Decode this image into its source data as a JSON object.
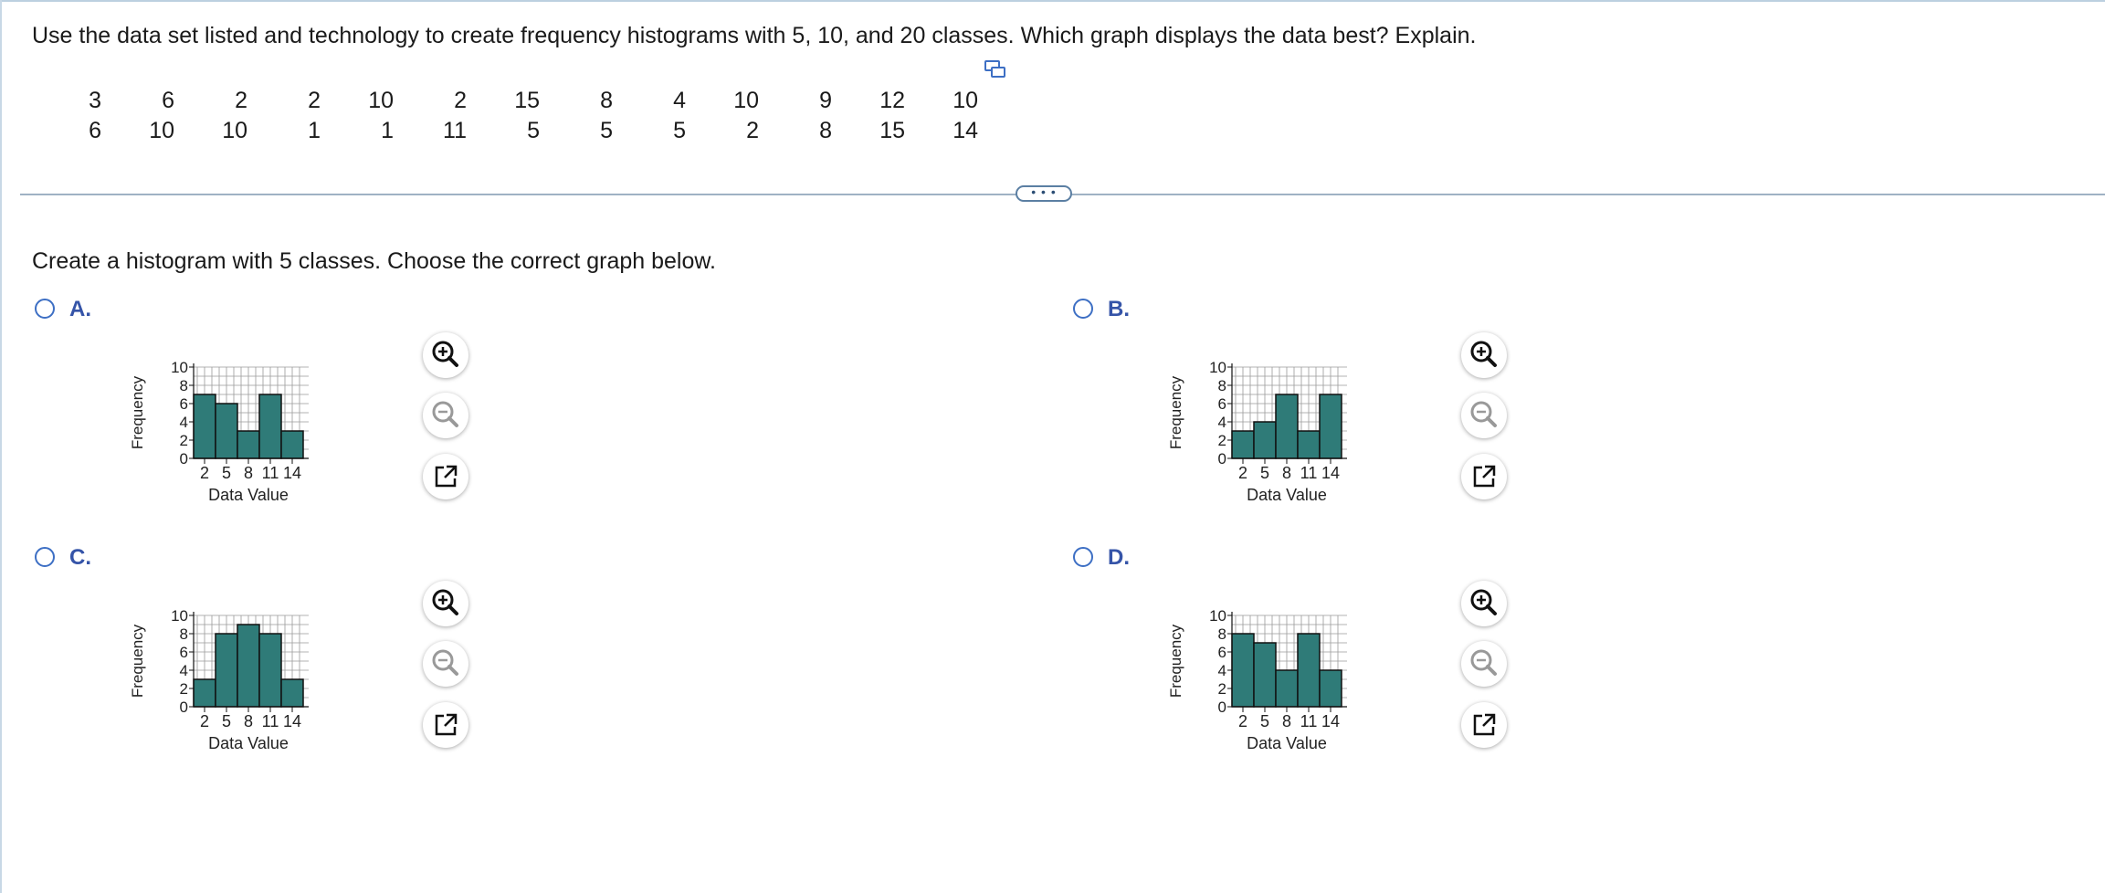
{
  "question": "Use the data set listed and technology to create frequency histograms with 5, 10, and 20 classes. Which graph displays the data best? Explain.",
  "data_rows": [
    [
      "3",
      "6",
      "2",
      "2",
      "10",
      "2",
      "15",
      "8",
      "4",
      "10",
      "9",
      "12",
      "10"
    ],
    [
      "6",
      "10",
      "10",
      "1",
      "1",
      "11",
      "5",
      "5",
      "5",
      "2",
      "8",
      "15",
      "14"
    ]
  ],
  "more_label": "• • •",
  "prompt": "Create a histogram with 5 classes. Choose the correct graph below.",
  "options": [
    {
      "letter": "A.",
      "chart_data": {
        "type": "bar",
        "ylabel": "Frequency",
        "xlabel": "Data Value",
        "xticks": [
          "2",
          "5",
          "8",
          "11",
          "14"
        ],
        "yticks": [
          "0",
          "2",
          "4",
          "6",
          "8",
          "10"
        ],
        "ylim": [
          0,
          10
        ],
        "values": [
          7,
          6,
          3,
          7,
          3
        ]
      }
    },
    {
      "letter": "B.",
      "chart_data": {
        "type": "bar",
        "ylabel": "Frequency",
        "xlabel": "Data Value",
        "xticks": [
          "2",
          "5",
          "8",
          "11",
          "14"
        ],
        "yticks": [
          "0",
          "2",
          "4",
          "6",
          "8",
          "10"
        ],
        "ylim": [
          0,
          10
        ],
        "values": [
          3,
          4,
          7,
          3,
          7
        ]
      }
    },
    {
      "letter": "C.",
      "chart_data": {
        "type": "bar",
        "ylabel": "Frequency",
        "xlabel": "Data Value",
        "xticks": [
          "2",
          "5",
          "8",
          "11",
          "14"
        ],
        "yticks": [
          "0",
          "2",
          "4",
          "6",
          "8",
          "10"
        ],
        "ylim": [
          0,
          10
        ],
        "values": [
          3,
          8,
          9,
          8,
          3
        ]
      }
    },
    {
      "letter": "D.",
      "chart_data": {
        "type": "bar",
        "ylabel": "Frequency",
        "xlabel": "Data Value",
        "xticks": [
          "2",
          "5",
          "8",
          "11",
          "14"
        ],
        "yticks": [
          "0",
          "2",
          "4",
          "6",
          "8",
          "10"
        ],
        "ylim": [
          0,
          10
        ],
        "values": [
          8,
          7,
          4,
          8,
          4
        ]
      }
    }
  ],
  "colors": {
    "bar": "#2f7b78",
    "accent": "#3d6fc4",
    "label": "#3554a8"
  },
  "icons": [
    "copy-icon",
    "zoom-in-icon",
    "zoom-out-icon",
    "open-new-window-icon"
  ]
}
